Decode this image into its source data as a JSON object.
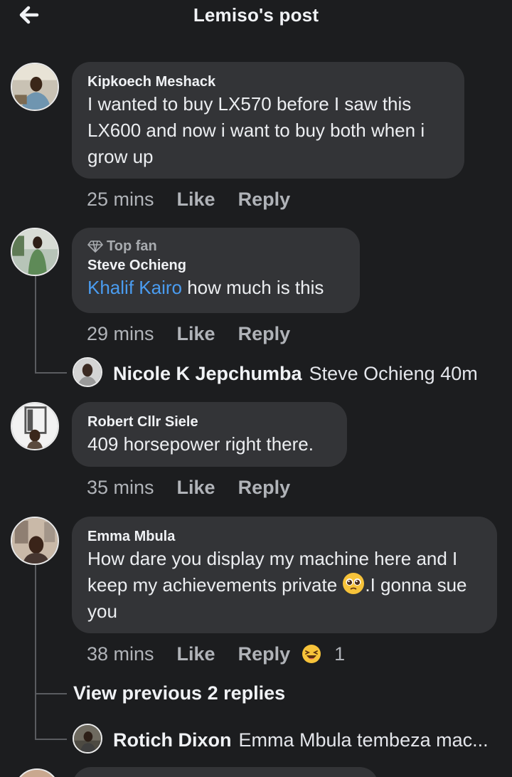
{
  "header": {
    "title": "Lemiso's post",
    "back_icon": "arrow-left-icon"
  },
  "colors": {
    "background": "#1c1d1f",
    "bubble": "#333437",
    "mention": "#4a9cf0",
    "muted": "#b0b3b8"
  },
  "comments": [
    {
      "author": "Kipkoech Meshack",
      "text": "I wanted to buy LX570 before I saw this LX600 and now i want to buy both when i grow up",
      "time": "25 mins",
      "like": "Like",
      "reply": "Reply"
    },
    {
      "badge": "Top fan",
      "author": "Steve Ochieng",
      "mention": "Khalif Kairo",
      "text": " how much is this",
      "time": "29 mins",
      "like": "Like",
      "reply": "Reply",
      "replies": [
        {
          "name": "Nicole K Jepchumba",
          "text": "Steve Ochieng 40m"
        }
      ]
    },
    {
      "author": "Robert Cllr Siele",
      "text": "409 horsepower right there.",
      "time": "35 mins",
      "like": "Like",
      "reply": "Reply"
    },
    {
      "author": "Emma Mbula",
      "text_part1": "How dare you display my machine here and I keep my achievements private ",
      "emoji": "pleading-face-emoji",
      "text_part2": ".I gonna sue you",
      "time": "38 mins",
      "like": "Like",
      "reply": "Reply",
      "reaction": "laughing-face-icon",
      "reaction_count": "1",
      "view_previous": "View previous 2 replies",
      "replies": [
        {
          "name": "Rotich Dixon",
          "text": "Emma Mbula tembeza mac..."
        }
      ]
    }
  ]
}
